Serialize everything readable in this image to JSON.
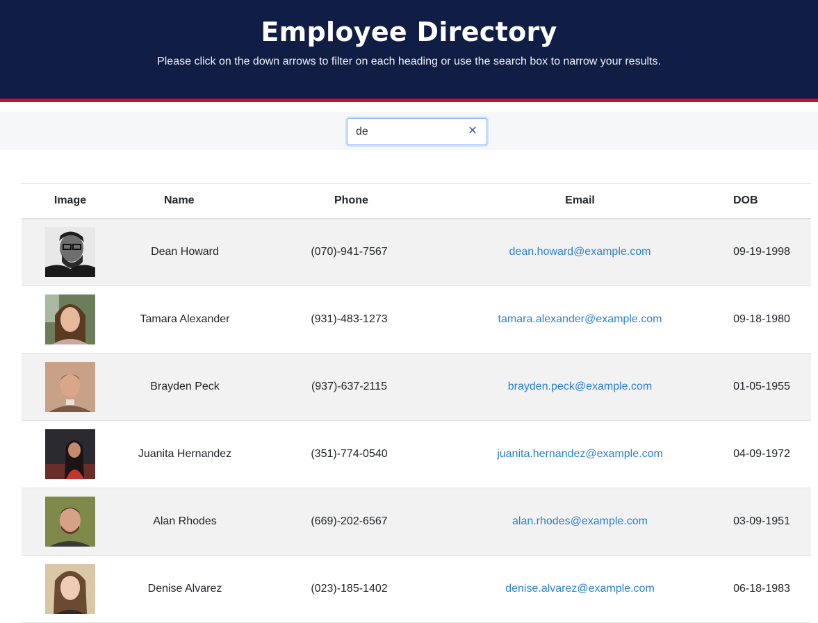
{
  "header": {
    "title": "Employee Directory",
    "subtitle": "Please click on the down arrows to filter on each heading or use the search box to narrow your results."
  },
  "search": {
    "value": "de",
    "clear_icon": "close-icon"
  },
  "table": {
    "columns": [
      "Image",
      "Name",
      "Phone",
      "Email",
      "DOB"
    ],
    "rows": [
      {
        "name": "Dean Howard",
        "phone": "(070)-941-7567",
        "email": "dean.howard@example.com",
        "dob": "09-19-1998",
        "avatar": "grayscale man with glasses"
      },
      {
        "name": "Tamara Alexander",
        "phone": "(931)-483-1273",
        "email": "tamara.alexander@example.com",
        "dob": "09-18-1980",
        "avatar": "woman with brown hair"
      },
      {
        "name": "Brayden Peck",
        "phone": "(937)-637-2115",
        "email": "brayden.peck@example.com",
        "dob": "01-05-1955",
        "avatar": "man with short hair"
      },
      {
        "name": "Juanita Hernandez",
        "phone": "(351)-774-0540",
        "email": "juanita.hernandez@example.com",
        "dob": "04-09-1972",
        "avatar": "woman in dark outdoor photo"
      },
      {
        "name": "Alan Rhodes",
        "phone": "(669)-202-6567",
        "email": "alan.rhodes@example.com",
        "dob": "03-09-1951",
        "avatar": "smiling bearded man"
      },
      {
        "name": "Denise Alvarez",
        "phone": "(023)-185-1402",
        "email": "denise.alvarez@example.com",
        "dob": "06-18-1983",
        "avatar": "woman with long hair"
      }
    ]
  },
  "colors": {
    "header_bg": "#101d45",
    "header_accent": "#c8102e",
    "link": "#2a7fd4",
    "row_stripe": "#f2f2f2"
  }
}
